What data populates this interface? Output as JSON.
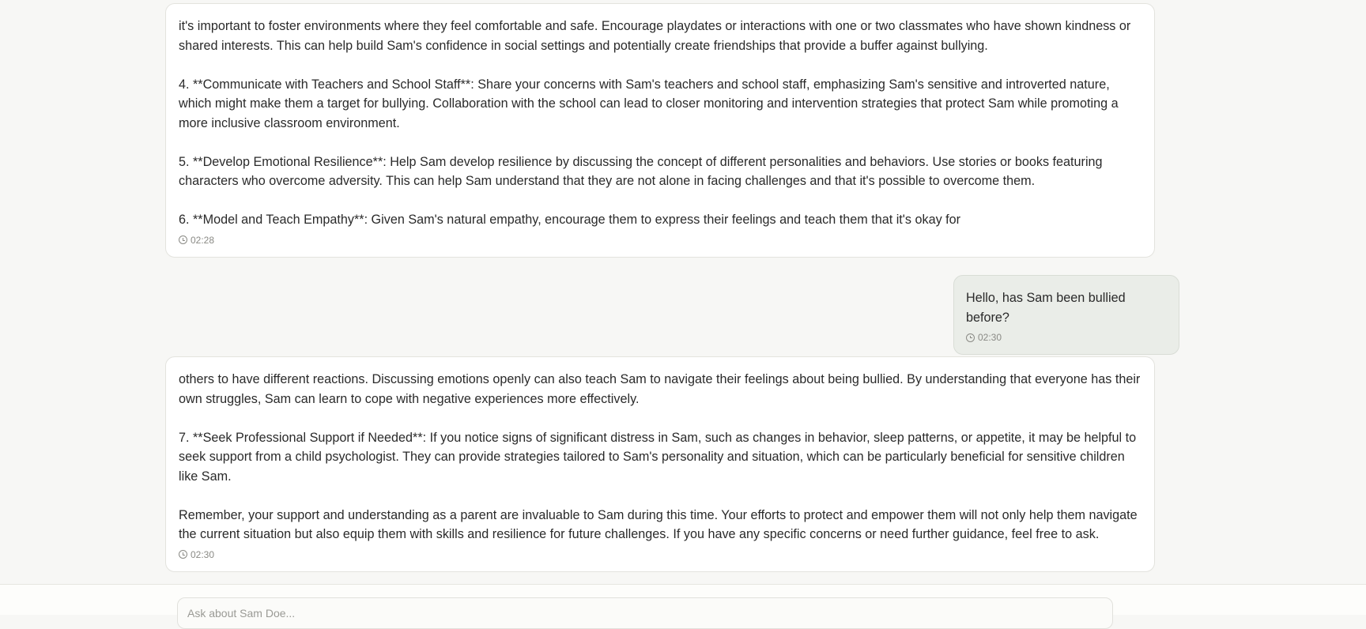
{
  "messages": [
    {
      "role": "assistant",
      "paragraphs": [
        "it's important to foster environments where they feel comfortable and safe. Encourage playdates or interactions with one or two classmates who have shown kindness or shared interests. This can help build Sam's confidence in social settings and potentially create friendships that provide a buffer against bullying.",
        "4. **Communicate with Teachers and School Staff**: Share your concerns with Sam's teachers and school staff, emphasizing Sam's sensitive and introverted nature, which might make them a target for bullying. Collaboration with the school can lead to closer monitoring and intervention strategies that protect Sam while promoting a more inclusive classroom environment.",
        "5. **Develop Emotional Resilience**: Help Sam develop resilience by discussing the concept of different personalities and behaviors. Use stories or books featuring characters who overcome adversity. This can help Sam understand that they are not alone in facing challenges and that it's possible to overcome them.",
        "6. **Model and Teach Empathy**: Given Sam's natural empathy, encourage them to express their feelings and teach them that it's okay for"
      ],
      "time": "02:28"
    },
    {
      "role": "user",
      "paragraphs": [
        "Hello, has Sam been bullied before?"
      ],
      "time": "02:30"
    },
    {
      "role": "assistant",
      "paragraphs": [
        "others to have different reactions. Discussing emotions openly can also teach Sam to navigate their feelings about being bullied. By understanding that everyone has their own struggles, Sam can learn to cope with negative experiences more effectively.",
        "7. **Seek Professional Support if Needed**: If you notice signs of significant distress in Sam, such as changes in behavior, sleep patterns, or appetite, it may be helpful to seek support from a child psychologist. They can provide strategies tailored to Sam's personality and situation, which can be particularly beneficial for sensitive children like Sam.",
        "Remember, your support and understanding as a parent are invaluable to Sam during this time. Your efforts to protect and empower them will not only help them navigate the current situation but also equip them with skills and resilience for future challenges. If you have any specific concerns or need further guidance, feel free to ask."
      ],
      "time": "02:30"
    }
  ],
  "composer": {
    "placeholder": "Ask about Sam Doe...",
    "value": ""
  },
  "icons": {
    "timestamp": "clock-icon"
  },
  "colors": {
    "background": "#f7f7f5",
    "assistant_bubble": "#ffffff",
    "user_bubble": "#eaede8",
    "text": "#2a2a2a",
    "muted": "#8a8a85"
  }
}
